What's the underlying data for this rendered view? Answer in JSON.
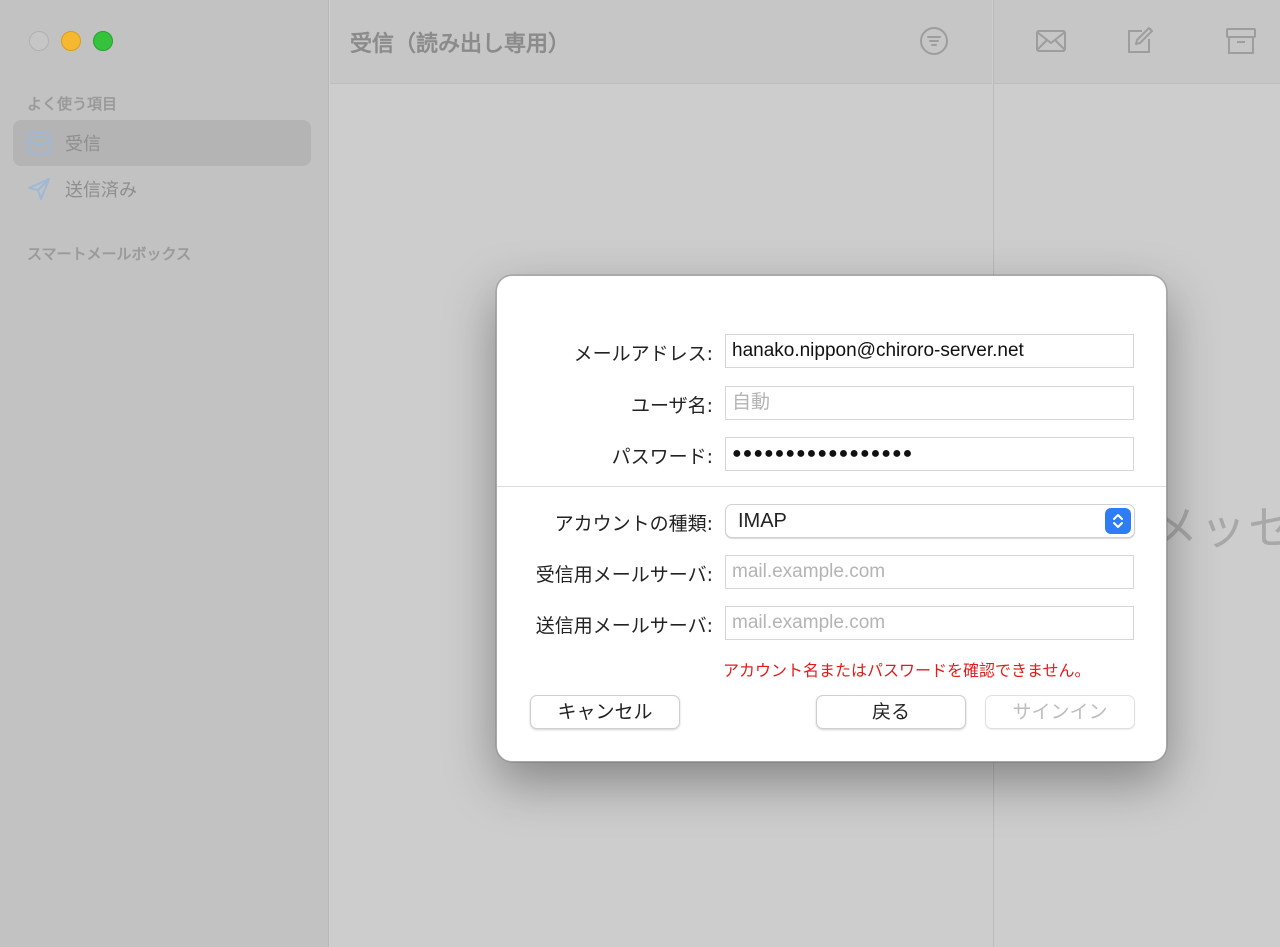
{
  "window": {
    "sidebar": {
      "favorites_label": "よく使う項目",
      "items": [
        {
          "label": "受信",
          "icon": "inbox-icon",
          "selected": true
        },
        {
          "label": "送信済み",
          "icon": "paper-plane-icon",
          "selected": false
        }
      ],
      "smart_mailboxes_label": "スマートメールボックス"
    },
    "list": {
      "title": "受信（読み出し専用）",
      "filter_icon": "filter-icon"
    },
    "toolbar": {
      "icons": [
        "envelope-icon",
        "compose-icon",
        "archive-icon"
      ]
    },
    "message_pane": {
      "placeholder_text": "メッセ"
    }
  },
  "dialog": {
    "email_label": "メールアドレス:",
    "email_value": "hanako.nippon@chiroro-server.net",
    "username_label": "ユーザ名:",
    "username_placeholder": "自動",
    "password_label": "パスワード:",
    "password_value": "●●●●●●●●●●●●●●●●●",
    "account_type_label": "アカウントの種類:",
    "account_type_value": "IMAP",
    "incoming_label": "受信用メールサーバ:",
    "incoming_placeholder": "mail.example.com",
    "outgoing_label": "送信用メールサーバ:",
    "outgoing_placeholder": "mail.example.com",
    "error_message": "アカウント名またはパスワードを確認できません。",
    "cancel_label": "キャンセル",
    "back_label": "戻る",
    "signin_label": "サインイン"
  },
  "colors": {
    "accent": "#2f7df6",
    "error": "#e21b1b",
    "traffic_close": "#c6c6c6",
    "traffic_minimize": "#f5b82e",
    "traffic_maximize": "#35c33d"
  }
}
